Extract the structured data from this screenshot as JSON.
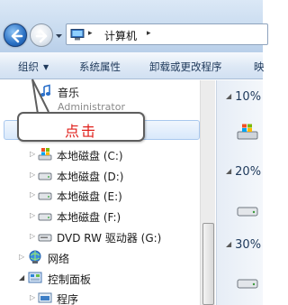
{
  "address_bar": {
    "separator": "▸",
    "location": "计算机"
  },
  "toolbar": {
    "organize": "组织",
    "system_properties": "系统属性",
    "uninstall": "卸载或更改程序",
    "map_drive_partial": "映"
  },
  "tree": {
    "music": "音乐",
    "user_partial": "Administrator",
    "drive_c": "本地磁盘 (C:)",
    "drive_d": "本地磁盘 (D:)",
    "drive_e": "本地磁盘 (E:)",
    "drive_f": "本地磁盘 (F:)",
    "dvd": "DVD RW 驱动器 (G:)",
    "network": "网络",
    "control_panel": "控制面板",
    "programs": "程序"
  },
  "content": {
    "group_1": "10%",
    "group_2": "20%",
    "group_3": "30%"
  },
  "callout": {
    "text": "点击"
  },
  "colors": {
    "callout_text": "#e0201b",
    "toolbar_text": "#1e395b",
    "selection": "#d9e9fb"
  },
  "icons": {
    "back": "back-arrow-icon",
    "forward": "forward-arrow-icon",
    "computer": "computer-icon",
    "music": "music-note-icon",
    "drive": "hard-drive-icon",
    "network": "network-globe-icon",
    "control_panel": "control-panel-icon"
  }
}
